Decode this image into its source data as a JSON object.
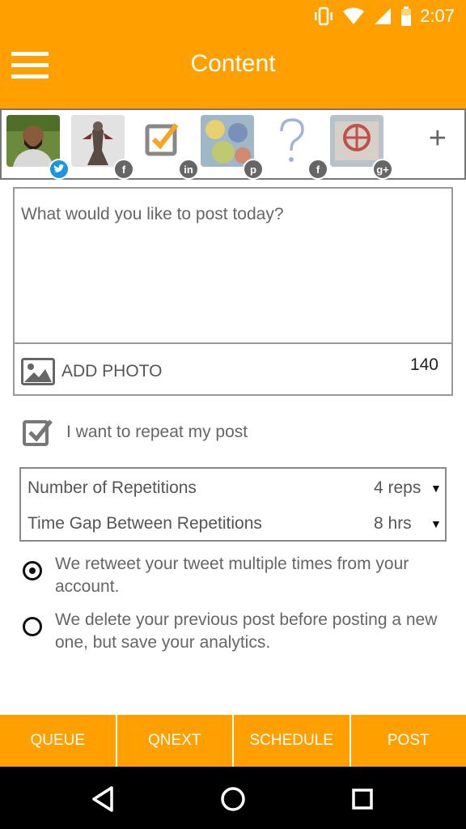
{
  "status_bar": {
    "time": "2:07"
  },
  "app_bar": {
    "title": "Content",
    "menu_icon": "hamburger-menu-icon"
  },
  "accounts": [
    {
      "name": "account-1",
      "network": "twitter",
      "badge": "t",
      "badge_color": "#1b95e0"
    },
    {
      "name": "account-2",
      "network": "facebook",
      "badge": "f",
      "badge_color": "#666666"
    },
    {
      "name": "account-3",
      "network": "linkedin",
      "badge": "in",
      "badge_color": "#666666"
    },
    {
      "name": "account-4",
      "network": "pinterest",
      "badge": "p",
      "badge_color": "#666666"
    },
    {
      "name": "account-5",
      "network": "facebook",
      "badge": "f",
      "badge_color": "#666666"
    },
    {
      "name": "account-6",
      "network": "google-plus",
      "badge": "g+",
      "badge_color": "#666666"
    }
  ],
  "add_account_label": "+",
  "composer": {
    "placeholder": "What would you like to post today?",
    "add_photo_label": "ADD PHOTO",
    "char_count": "140"
  },
  "repeat": {
    "label": "I want to repeat my post",
    "checked": true
  },
  "repetitions": {
    "count_label": "Number of Repetitions",
    "count_value": "4 reps",
    "gap_label": "Time Gap Between Repetitions",
    "gap_value": "8 hrs"
  },
  "repeat_modes": [
    {
      "text": "We retweet your tweet multiple times from your account.",
      "selected": true
    },
    {
      "text": "We delete your previous post before posting a new one, but save your analytics.",
      "selected": false
    }
  ],
  "bottom_tabs": [
    "QUEUE",
    "QNEXT",
    "SCHEDULE",
    "POST"
  ],
  "colors": {
    "accent": "#ffa000",
    "twitter": "#1b95e0"
  }
}
